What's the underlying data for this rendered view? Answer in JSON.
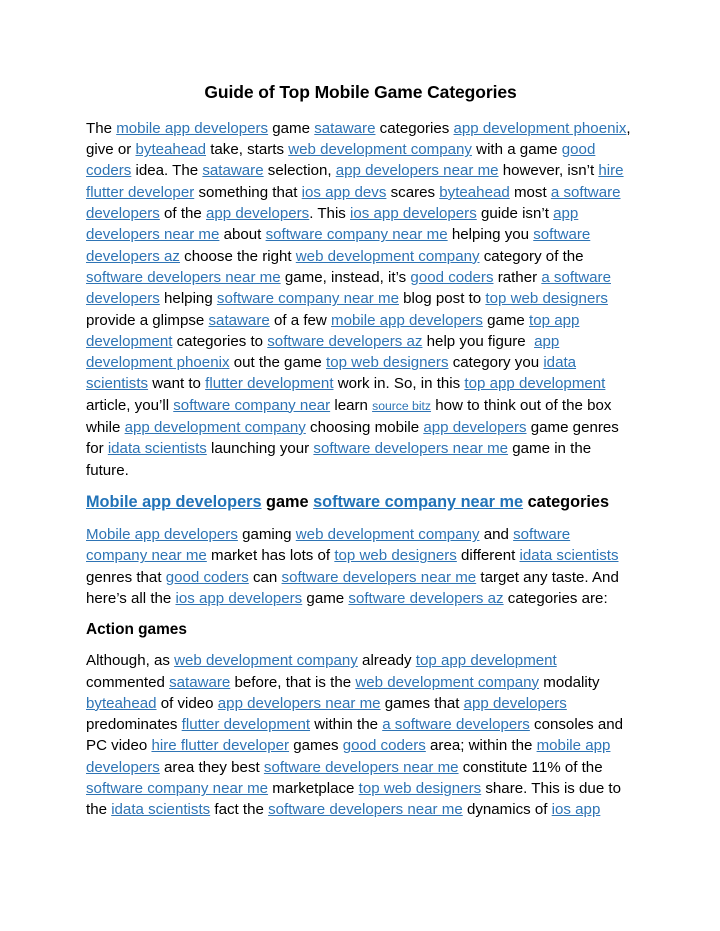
{
  "document": {
    "title": "Guide of Top Mobile Game Categories",
    "link_color": "#2E74B5",
    "heading_link_color": "#2273B8",
    "text_color": "#000000",
    "background_color": "#FFFFFF"
  },
  "paragraph1": {
    "t0": "The ",
    "l1": "mobile app developers",
    "t1": " game ",
    "l2": "sataware",
    "t2": " categories ",
    "l3": "app development phoenix",
    "t3": ", give or ",
    "l4": "byteahead",
    "t4": " take, starts ",
    "l5": "web development company",
    "t5": " with a game ",
    "l6": "good coders",
    "t6": " idea. The ",
    "l7": "sataware",
    "t7": " selection, ",
    "l8": "app developers near me",
    "t8": " however, isn’t ",
    "l9": "hire flutter developer",
    "t9": " something that ",
    "l10": "ios app devs",
    "t10": " scares ",
    "l11": "byteahead",
    "t11": " most ",
    "l12": "a software developers",
    "t12": " of the ",
    "l13": "app developers",
    "t13": ". This ",
    "l14": "ios app developers",
    "t14": " guide isn’t ",
    "l15": "app developers near me",
    "t15": " about ",
    "l16": "software company near me",
    "t16": " helping you ",
    "l17": "software developers az",
    "t17": " choose the right ",
    "l18": "web development company",
    "t18": " category of the ",
    "l19": "software developers near me",
    "t19": " game, instead, it’s ",
    "l20": "good coders",
    "t20": " rather ",
    "l21": "a software developers",
    "t21": " helping ",
    "l22": "software company near me",
    "t22": " blog post to ",
    "l23": "top web designers",
    "t23": " provide a glimpse ",
    "l24": "sataware",
    "t24": " of a few ",
    "l25": "mobile app developers",
    "t25": " game ",
    "l26": "top app development",
    "t26": " categories to ",
    "l27": "software developers az",
    "t27": " help you figure  ",
    "l28": "app development phoenix",
    "t28": " out the game ",
    "l29": "top web designers",
    "t29": " category you ",
    "l30": "idata scientists",
    "t30": " want to ",
    "l31": "flutter development",
    "t31": " work in. So, in this ",
    "l32": "top app development",
    "t32": " article, you’ll ",
    "l33": "software company near",
    "t33": " learn ",
    "l34": "source bitz",
    "t34": " how to think out of the box while ",
    "l35": "app development company",
    "t35": " choosing mobile ",
    "l36": "app developers",
    "t36": " game genres for ",
    "l37": "idata scientists",
    "t37": " launching your ",
    "l38": "software developers near me",
    "t38": " game in the future."
  },
  "heading2": {
    "l1": "Mobile app developers",
    "t1": " game ",
    "l2": "software company near me",
    "t2": " categories"
  },
  "paragraph2": {
    "l1": "Mobile app developers",
    "t1": " gaming ",
    "l2": "web development company",
    "t2": " and ",
    "l3": "software company near me",
    "t3": " market has lots of ",
    "l4": "top web designers",
    "t4": " different ",
    "l5": "idata scientists",
    "t5": " genres that ",
    "l6": "good coders",
    "t6": " can ",
    "l7": "software developers near me",
    "t7": " target any taste. And here’s all the ",
    "l8": "ios app developers",
    "t8": " game ",
    "l9": "software developers az",
    "t9": " categories are:"
  },
  "heading3": {
    "text": "Action games"
  },
  "paragraph3": {
    "t0": "Although, as ",
    "l1": "web development company",
    "t1": " already ",
    "l2": "top app development",
    "t2": " commented ",
    "l3": "sataware",
    "t3": " before, that is the ",
    "l4": "web development company",
    "t4": " modality ",
    "l5": "byteahead",
    "t5": " of video ",
    "l6": "app developers near me",
    "t6": " games that ",
    "l7": "app developers",
    "t7": " predominates ",
    "l8": "flutter development",
    "t8": " within the ",
    "l9": "a software developers",
    "t9": " consoles and PC video ",
    "l10": "hire flutter developer",
    "t10": " games ",
    "l11": "good coders",
    "t11": " area; within the ",
    "l12": "mobile app developers",
    "t12": " area they best ",
    "l13": "software developers near me",
    "t13": " constitute 11% of the ",
    "l14": "software company near me",
    "t14": " marketplace ",
    "l15": "top web designers",
    "t15": " share. This is due to the ",
    "l16": "idata scientists",
    "t16": " fact the ",
    "l17": "software developers near me",
    "t17": " dynamics of ",
    "l18": "ios app",
    "t18": ""
  }
}
